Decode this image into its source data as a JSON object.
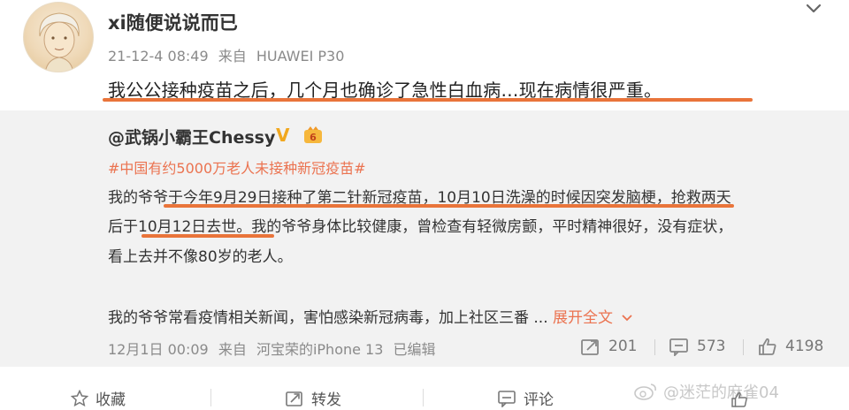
{
  "post": {
    "author": "xi随便说说而已",
    "time": "21-12-4 08:49",
    "source_prefix": "来自",
    "device": "HUAWEI P30",
    "text": "我公公接种疫苗之后，几个月也确诊了急性白血病…现在病情很严重。"
  },
  "repost": {
    "author": "@武锅小霸王Chessy",
    "verified_mark": "V",
    "topic": "#中国有约5000万老人未接种新冠疫苗#",
    "line1": "我的爷爷于今年9月29日接种了第二针新冠疫苗，10月10日洗澡的时候因突发脑梗，抢救两天",
    "line2": "后于10月12日去世。我的爷爷身体比较健康，曾检查有轻微房颤，平时精神很好，没有症状，",
    "line3": "看上去并不像80岁的老人。",
    "line4": "我的爷爷常看疫情相关新闻，害怕感染新冠病毒，加上社区三番 ...",
    "expand_label": "展开全文",
    "time": "12月1日 00:09",
    "source_prefix": "来自",
    "device": "河宝荣的iPhone 13",
    "edited": "已编辑",
    "repost_count": "201",
    "comment_count": "573",
    "like_count": "4198"
  },
  "bottom_bar": {
    "favorite_label": "收藏",
    "repost_label": "转发",
    "comment_label": "评论"
  },
  "watermark": "@迷茫的麻雀04",
  "colors": {
    "accent": "#eb7350",
    "underline": "#e9743a",
    "muted": "#8a8a8a",
    "repost_bg": "#f2f2f2"
  }
}
